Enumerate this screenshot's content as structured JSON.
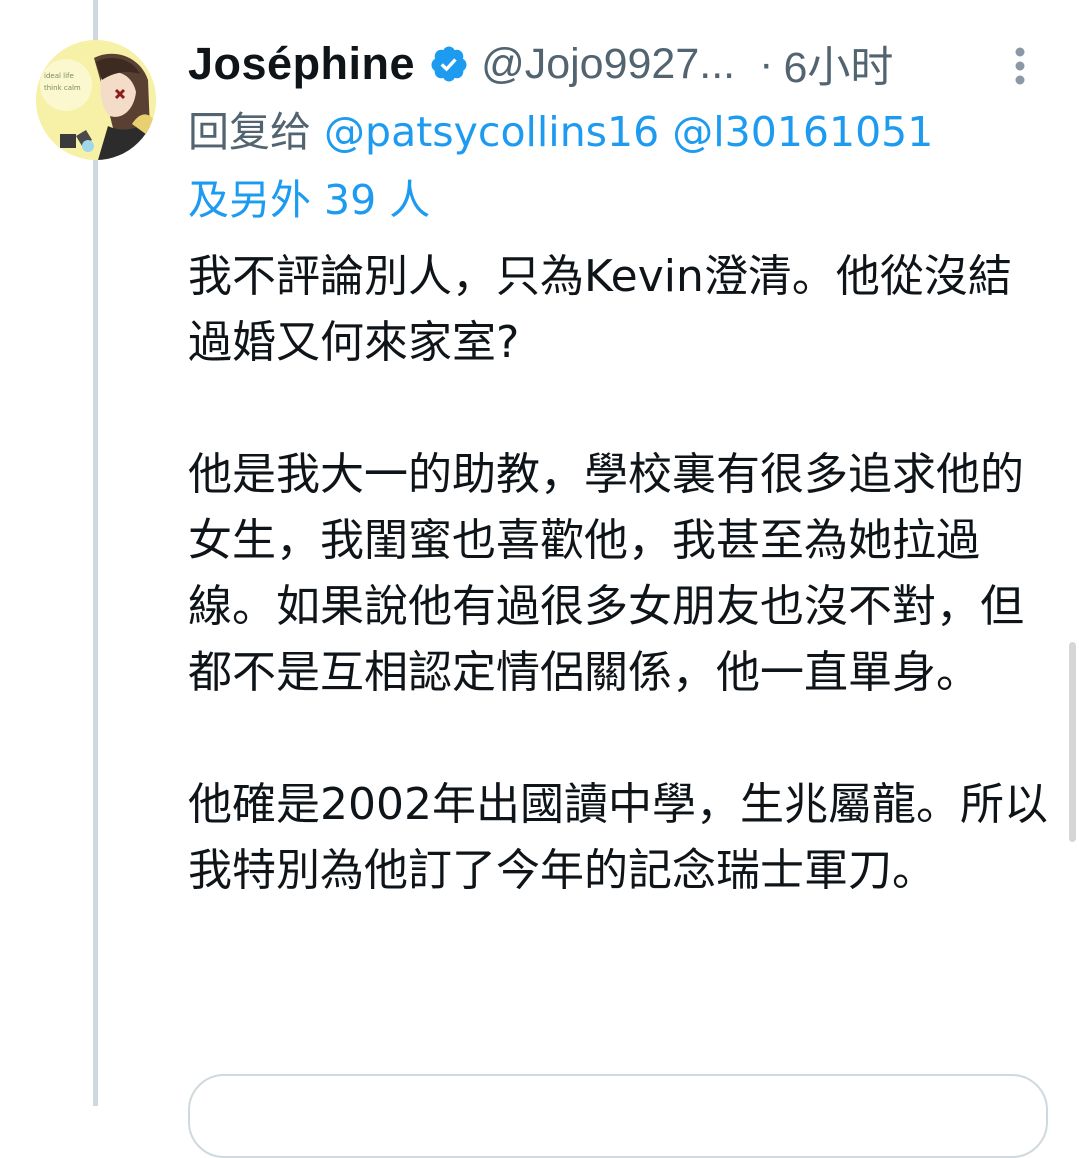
{
  "tweet": {
    "author": {
      "display_name": "Joséphine",
      "handle": "@Jojo9927...",
      "verified": true,
      "avatar_icon": "profile-avatar-illustration"
    },
    "separator": "·",
    "time": "6小时",
    "reply_prefix": "回复给",
    "reply_users": [
      "@patsycollins16",
      "@l30161051"
    ],
    "reply_others": "及另外 39 人",
    "paragraphs": [
      "我不評論別人，只為Kevin澄清。他從沒結過婚又何來家室?",
      "他是我大一的助教，學校裏有很多追求他的女生，我閨蜜也喜歡他，我甚至為她拉過線。如果說他有過很多女朋友也沒不對，但都不是互相認定情侶關係，他一直單身。",
      "他確是2002年出國讀中學，生兆屬龍。所以我特別為他訂了今年的記念瑞士軍刀。"
    ]
  },
  "colors": {
    "link": "#1d9bf0",
    "secondary_text": "#536471",
    "primary_text": "#0f1419",
    "thread_line": "#cfd9de"
  },
  "icons": {
    "verified": "verified-badge-icon",
    "more": "more-vertical-icon"
  }
}
